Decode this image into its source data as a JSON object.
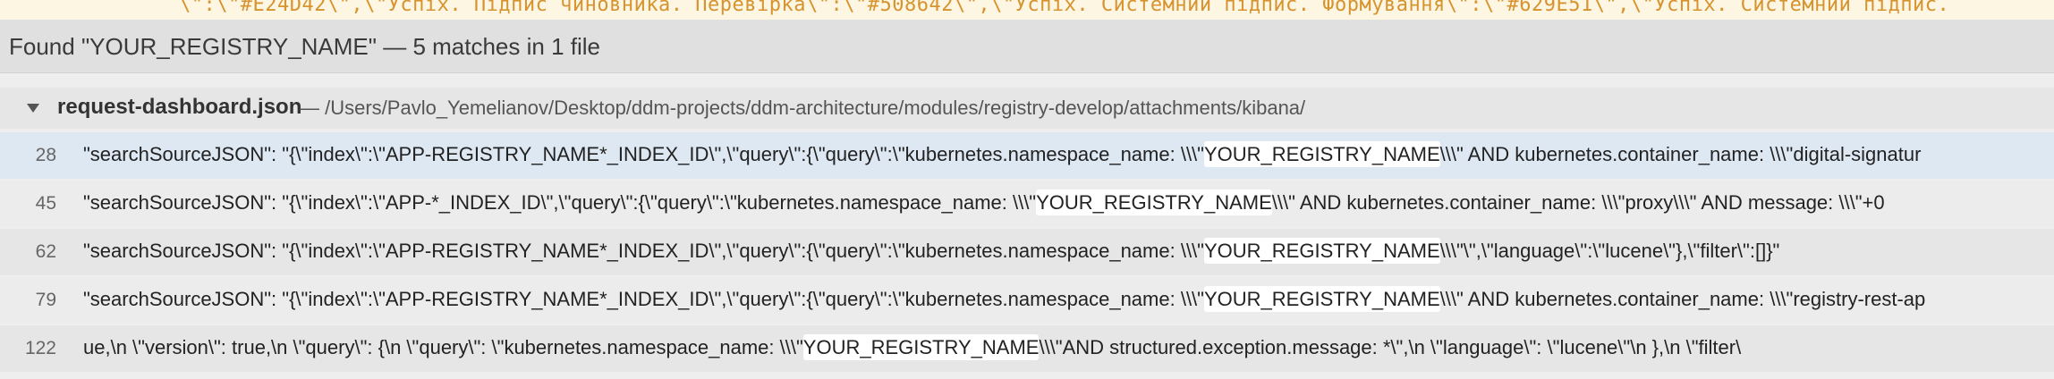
{
  "editor": {
    "partial_line": "\\\":\\\"#E24D42\\\",\\\"Успіх. Підпис чиновника. Перевірка\\\":\\\"#508642\\\",\\\"Успіх. Системний підпис. Формування\\\":\\\"#629E51\\\",\\\"Успіх. Системний підпис."
  },
  "find": {
    "title": "Found \"YOUR_REGISTRY_NAME\" — 5 matches in 1 file",
    "query": "YOUR_REGISTRY_NAME"
  },
  "file": {
    "name": "request-dashboard.json",
    "path": " — /Users/Pavlo_Yemelianov/Desktop/ddm-projects/ddm-architecture/modules/registry-develop/attachments/kibana/"
  },
  "results": [
    {
      "line": "28",
      "before": "\"searchSourceJSON\": \"{\\\"index\\\":\\\"APP-REGISTRY_NAME*_INDEX_ID\\\",\\\"query\\\":{\\\"query\\\":\\\"kubernetes.namespace_name: \\\\\\\"",
      "match": "YOUR_REGISTRY_NAME",
      "after": "\\\\\\\" AND kubernetes.container_name: \\\\\\\"digital-signatur"
    },
    {
      "line": "45",
      "before": "\"searchSourceJSON\": \"{\\\"index\\\":\\\"APP-*_INDEX_ID\\\",\\\"query\\\":{\\\"query\\\":\\\"kubernetes.namespace_name: \\\\\\\"",
      "match": "YOUR_REGISTRY_NAME",
      "after": "\\\\\\\" AND kubernetes.container_name: \\\\\\\"proxy\\\\\\\" AND message: \\\\\\\"+0"
    },
    {
      "line": "62",
      "before": "\"searchSourceJSON\": \"{\\\"index\\\":\\\"APP-REGISTRY_NAME*_INDEX_ID\\\",\\\"query\\\":{\\\"query\\\":\\\"kubernetes.namespace_name: \\\\\\\"",
      "match": "YOUR_REGISTRY_NAME",
      "after": "\\\\\\\"\\\",\\\"language\\\":\\\"lucene\\\"},\\\"filter\\\":[]}\""
    },
    {
      "line": "79",
      "before": "\"searchSourceJSON\": \"{\\\"index\\\":\\\"APP-REGISTRY_NAME*_INDEX_ID\\\",\\\"query\\\":{\\\"query\\\":\\\"kubernetes.namespace_name: \\\\\\\"",
      "match": "YOUR_REGISTRY_NAME",
      "after": "\\\\\\\" AND kubernetes.container_name: \\\\\\\"registry-rest-ap"
    },
    {
      "line": "122",
      "before": "ue,\\n \\\"version\\\": true,\\n \\\"query\\\": {\\n \\\"query\\\": \\\"kubernetes.namespace_name: \\\\\\\"",
      "match": "YOUR_REGISTRY_NAME",
      "after": "\\\\\\\"AND structured.exception.message: *\\\",\\n \\\"language\\\": \\\"lucene\\\"\\n },\\n \\\"filter\\"
    }
  ]
}
